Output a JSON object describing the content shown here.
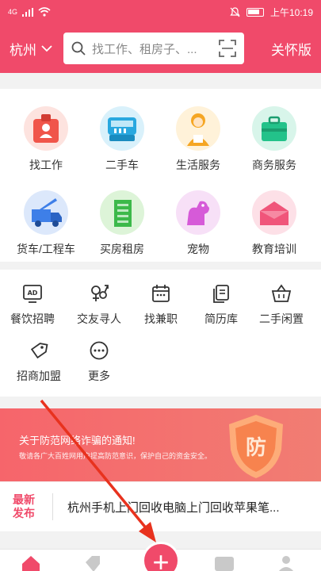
{
  "status": {
    "signal": "4G",
    "time": "上午10:19"
  },
  "header": {
    "city": "杭州",
    "search_placeholder": "找工作、租房子、...",
    "care_mode": "关怀版"
  },
  "categories": [
    {
      "label": "找工作",
      "icon": "job-icon"
    },
    {
      "label": "二手车",
      "icon": "used-car-icon"
    },
    {
      "label": "生活服务",
      "icon": "life-service-icon"
    },
    {
      "label": "商务服务",
      "icon": "business-service-icon"
    },
    {
      "label": "货车/工程车",
      "icon": "truck-icon"
    },
    {
      "label": "买房租房",
      "icon": "house-icon"
    },
    {
      "label": "宠物",
      "icon": "pet-icon"
    },
    {
      "label": "教育培训",
      "icon": "education-icon"
    }
  ],
  "shortcuts": [
    {
      "label": "餐饮招聘",
      "icon": "ad-icon"
    },
    {
      "label": "交友寻人",
      "icon": "gender-icon"
    },
    {
      "label": "找兼职",
      "icon": "calendar-icon"
    },
    {
      "label": "简历库",
      "icon": "resume-icon"
    },
    {
      "label": "二手闲置",
      "icon": "basket-icon"
    },
    {
      "label": "招商加盟",
      "icon": "tag-icon"
    },
    {
      "label": "更多",
      "icon": "more-icon"
    }
  ],
  "banner": {
    "title": "关于防范网络诈骗的通知!",
    "subtitle": "敬请各广大百姓网用户提高防范意识，保护自己的资金安全。",
    "badge": "防"
  },
  "news": {
    "tag_line1": "最新",
    "tag_line2": "发布",
    "headline": "杭州手机上门回收电脑上门回收苹果笔..."
  },
  "tabbar": {
    "plus": "+"
  },
  "colors": {
    "brand": "#f04a6a",
    "annotation_arrow": "#e8321e"
  }
}
